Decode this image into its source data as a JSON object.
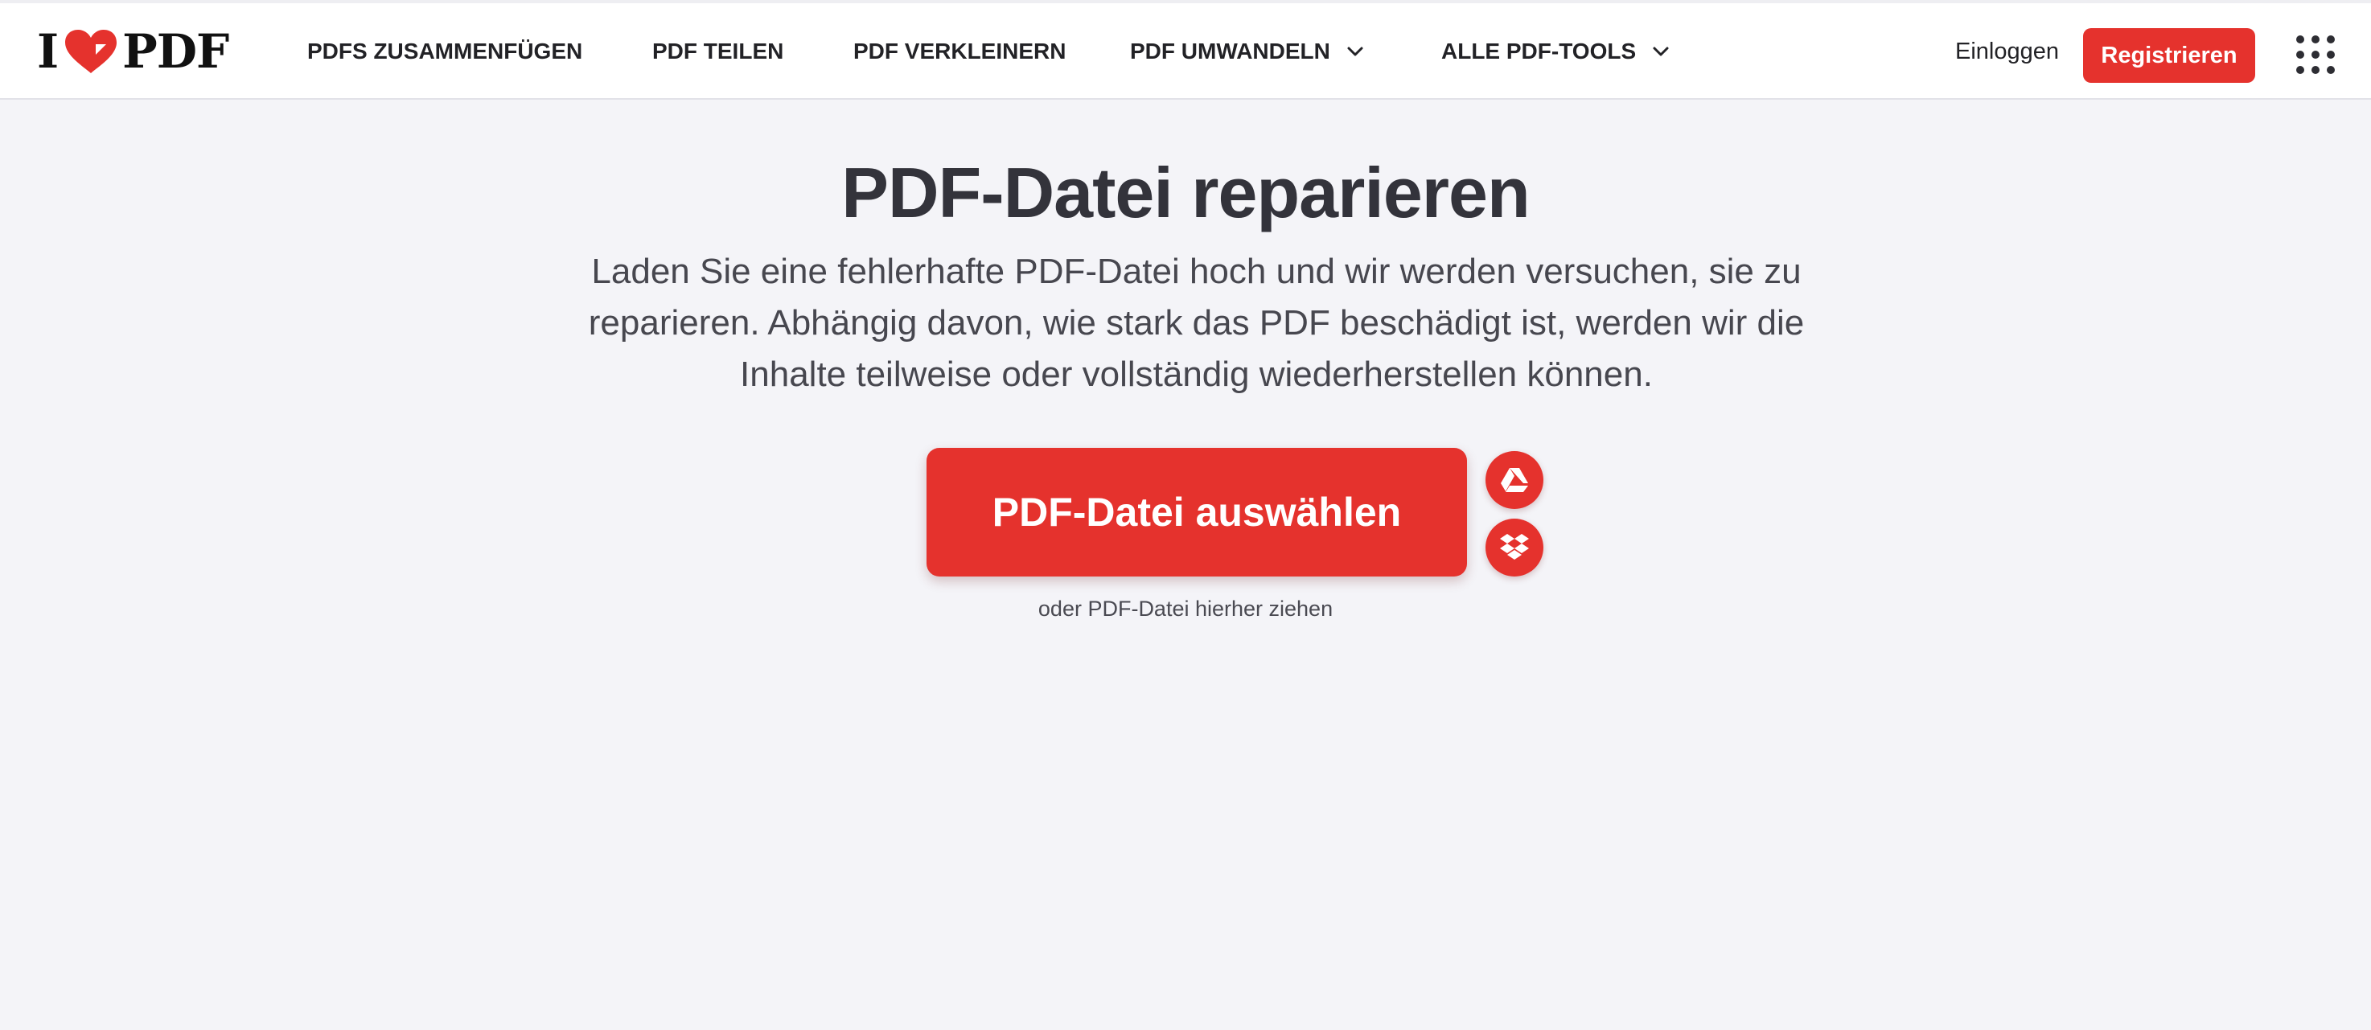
{
  "header": {
    "logo": {
      "prefix": "I",
      "suffix": "PDF"
    },
    "nav": [
      {
        "label": "PDFS ZUSAMMENFÜGEN",
        "has_dropdown": false
      },
      {
        "label": "PDF TEILEN",
        "has_dropdown": false
      },
      {
        "label": "PDF VERKLEINERN",
        "has_dropdown": false
      },
      {
        "label": "PDF UMWANDELN",
        "has_dropdown": true
      },
      {
        "label": "ALLE PDF-TOOLS",
        "has_dropdown": true
      }
    ],
    "login_label": "Einloggen",
    "register_label": "Registrieren",
    "apps_icon": "grid-icon"
  },
  "main": {
    "title": "PDF-Datei reparieren",
    "description": "Laden Sie eine fehlerhafte PDF-Datei hoch und wir werden versuchen, sie zu reparieren. Abhängig davon, wie stark das PDF beschädigt ist, werden wir die Inhalte teilweise oder vollständig wiederherstellen können.",
    "select_button_label": "PDF-Datei auswählen",
    "cloud_sources": [
      {
        "icon": "google-drive-icon"
      },
      {
        "icon": "dropbox-icon"
      }
    ],
    "drop_hint": "oder PDF-Datei hierher ziehen"
  },
  "colors": {
    "accent": "#e5322d",
    "background": "#f4f4f8",
    "header_background": "#ffffff",
    "text": "#33333b"
  }
}
